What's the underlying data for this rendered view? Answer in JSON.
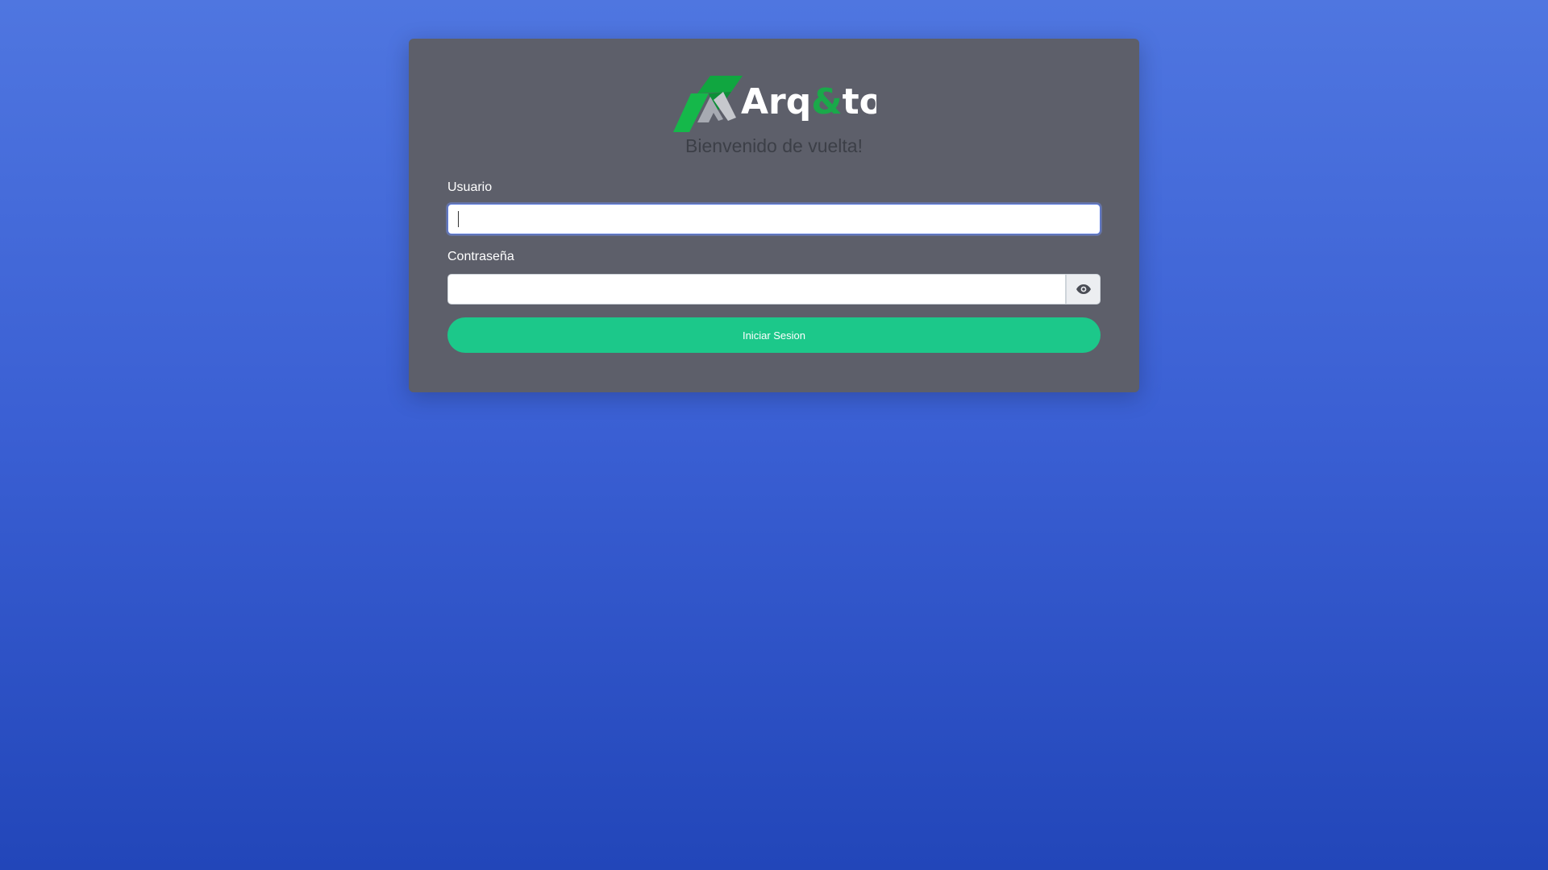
{
  "brand": {
    "name_part1": "Arq",
    "name_amp": "&",
    "name_part2": "top",
    "accent_color": "#1aa94a",
    "logo_icon": "mountain-logo-icon"
  },
  "welcome_text": "Bienvenido de vuelta!",
  "form": {
    "username_label": "Usuario",
    "username_value": "",
    "password_label": "Contraseña",
    "password_value": "",
    "toggle_icon": "eye-icon",
    "submit_label": "Iniciar Sesion"
  },
  "colors": {
    "background_top": "#4f76e0",
    "background_bottom": "#2246b9",
    "card": "#5d5f6a",
    "button": "#1cc88a"
  }
}
